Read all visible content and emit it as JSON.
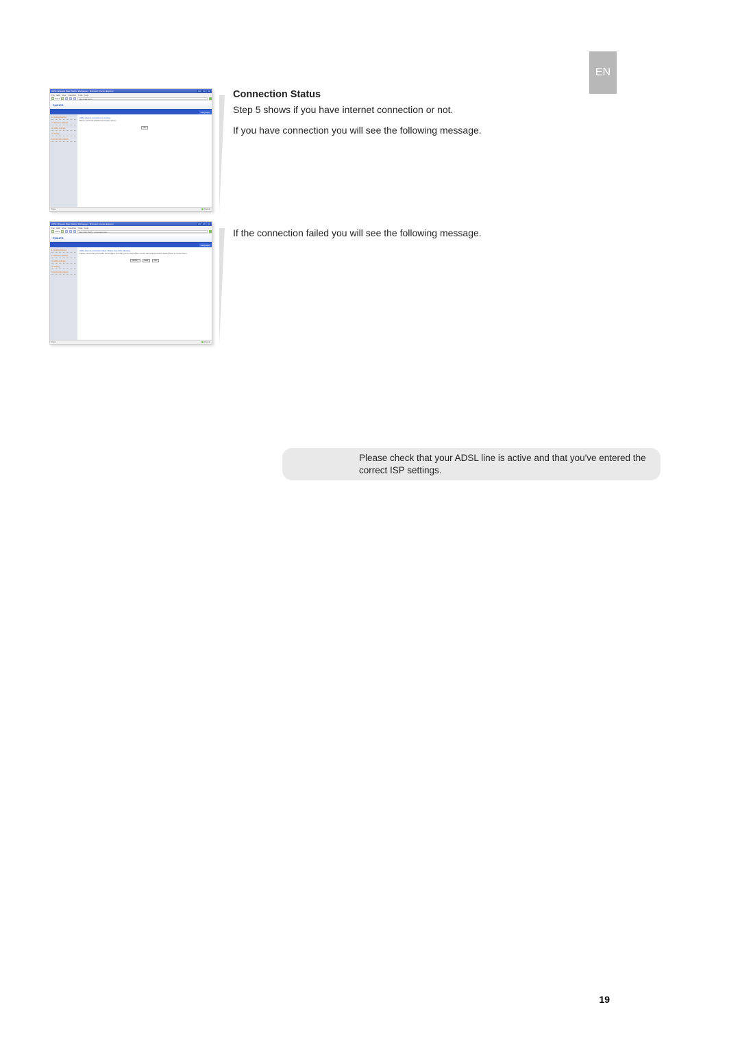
{
  "language_tab": "EN",
  "section": {
    "title": "Connection Status",
    "intro": "Step 5 shows if you have internet connection or not.",
    "success_note": "If you have connection you will see the following message.",
    "fail_note": "If the connection failed you will see the following message.",
    "warning": "Please check that your ADSL line is active and that you've entered the correct ISP settings."
  },
  "page_number": "19",
  "screenshot_common": {
    "brand": "PHILIPS",
    "menu": [
      "File",
      "Edit",
      "View",
      "Favorites",
      "Tools",
      "Help"
    ],
    "toolbar_back": "Back",
    "status_left": "Done",
    "status_right": "Internet",
    "language_label": "Language"
  },
  "screenshot1": {
    "titlebar": "ADSL Wireless Base Station Webpages - Microsoft Internet Explorer",
    "address": "http://192.168.1",
    "sidebar": [
      "1. Getting Started",
      "2. Wireless settings",
      "3. ADSL settings",
      "4. Saving",
      "5.Connection status"
    ],
    "main_line1": "ADSL internet connection is working.",
    "main_line2": "Below you'll find detailed information about...",
    "buttons": [
      "OK"
    ]
  },
  "screenshot2": {
    "titlebar": "ADSL Wireless Base Station Webpages - Microsoft Internet Explorer",
    "address": "http://192.168.1/...connection.stm",
    "sidebar": [
      "1. Getting Started",
      "2. Wireless settings",
      "3. ADSL settings",
      "4. Saving",
      "5.Connection status"
    ],
    "main_line1": "ADSL internet connection failed. Please check the following:",
    "main_line2": "Please check that your ADSL line is active and that you've entered the correct ISP settings before clicking back to correct them.",
    "buttons": [
      "RETRY",
      "Back",
      "OK"
    ]
  }
}
